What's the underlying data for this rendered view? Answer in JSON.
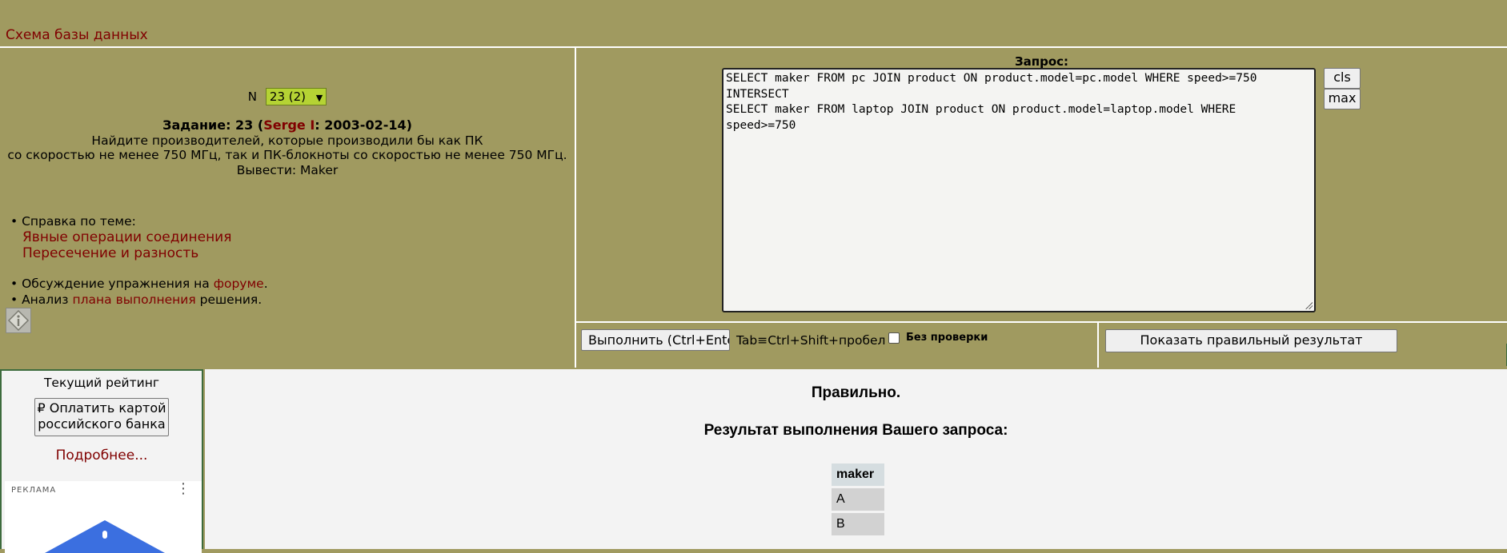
{
  "header": {
    "schema_link": "Схема базы данных"
  },
  "task": {
    "n_label": "N",
    "selected": "23 (2)",
    "title_prefix": "Задание: 23 (",
    "author": "Serge I",
    "title_suffix": ": 2003-02-14)",
    "line1": "Найдите производителей, которые производили бы как ПК",
    "line2": "со скоростью не менее 750 МГц, так и ПК-блокноты со скоростью не менее 750 МГц.",
    "line3": "Вывести: Maker"
  },
  "help": {
    "title": "• Справка по теме:",
    "links": [
      "Явные операции соединения",
      "Пересечение и разность"
    ]
  },
  "discussion": {
    "prefix": "• Обсуждение упражнения на ",
    "link": "форуме",
    "suffix": "."
  },
  "analysis": {
    "prefix": "• Анализ ",
    "link": "плана выполнения",
    "suffix": " решения."
  },
  "query": {
    "label": "Запрос:",
    "text": "SELECT maker FROM pc JOIN product ON product.model=pc.model WHERE speed>=750\nINTERSECT\nSELECT maker FROM laptop JOIN product ON product.model=laptop.model WHERE\nspeed>=750",
    "cls_label": "cls",
    "max_label": "max"
  },
  "exec": {
    "button": "Выполнить (Ctrl+Enter)",
    "tab_hint": "Tab≡Ctrl+Shift+пробел",
    "no_check": "Без проверки"
  },
  "show_result": {
    "button": "Показать правильный результат"
  },
  "rating": {
    "title": "Текущий рейтинг",
    "pay_button": "₽ Оплатить картой российского банка",
    "more_link": "Подробнее..."
  },
  "ad": {
    "label": "РЕКЛАМА"
  },
  "result": {
    "status": "Правильно.",
    "heading": "Результат выполнения Вашего запроса:",
    "columns": [
      "maker"
    ],
    "rows": [
      [
        "A"
      ],
      [
        "B"
      ]
    ]
  },
  "colors": {
    "background": "#a09a60",
    "link": "#800000",
    "select_bg": "#b5d334",
    "result_bg": "#f3f3f3"
  }
}
